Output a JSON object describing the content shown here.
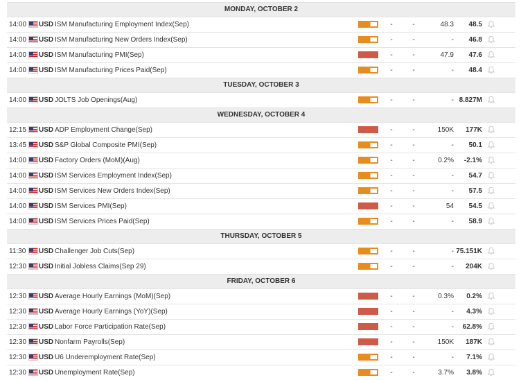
{
  "days": [
    {
      "label": "MONDAY, OCTOBER 2",
      "events": [
        {
          "time": "14:00",
          "currency": "USD",
          "name": "ISM Manufacturing Employment Index(Sep)",
          "impact": "medium",
          "actual": "-",
          "deviation": "-",
          "consensus": "48.3",
          "previous": "48.5"
        },
        {
          "time": "14:00",
          "currency": "USD",
          "name": "ISM Manufacturing New Orders Index(Sep)",
          "impact": "medium",
          "actual": "-",
          "deviation": "-",
          "consensus": "-",
          "previous": "46.8"
        },
        {
          "time": "14:00",
          "currency": "USD",
          "name": "ISM Manufacturing PMI(Sep)",
          "impact": "high",
          "actual": "-",
          "deviation": "-",
          "consensus": "47.9",
          "previous": "47.6"
        },
        {
          "time": "14:00",
          "currency": "USD",
          "name": "ISM Manufacturing Prices Paid(Sep)",
          "impact": "medium",
          "actual": "-",
          "deviation": "-",
          "consensus": "-",
          "previous": "48.4"
        }
      ]
    },
    {
      "label": "TUESDAY, OCTOBER 3",
      "events": [
        {
          "time": "14:00",
          "currency": "USD",
          "name": "JOLTS Job Openings(Aug)",
          "impact": "medium",
          "actual": "-",
          "deviation": "-",
          "consensus": "-",
          "previous": "8.827M"
        }
      ]
    },
    {
      "label": "WEDNESDAY, OCTOBER 4",
      "events": [
        {
          "time": "12:15",
          "currency": "USD",
          "name": "ADP Employment Change(Sep)",
          "impact": "high",
          "actual": "-",
          "deviation": "-",
          "consensus": "150K",
          "previous": "177K"
        },
        {
          "time": "13:45",
          "currency": "USD",
          "name": "S&P Global Composite PMI(Sep)",
          "impact": "medium",
          "actual": "-",
          "deviation": "-",
          "consensus": "-",
          "previous": "50.1"
        },
        {
          "time": "14:00",
          "currency": "USD",
          "name": "Factory Orders (MoM)(Aug)",
          "impact": "medium",
          "actual": "-",
          "deviation": "-",
          "consensus": "0.2%",
          "previous": "-2.1%"
        },
        {
          "time": "14:00",
          "currency": "USD",
          "name": "ISM Services Employment Index(Sep)",
          "impact": "medium",
          "actual": "-",
          "deviation": "-",
          "consensus": "-",
          "previous": "54.7"
        },
        {
          "time": "14:00",
          "currency": "USD",
          "name": "ISM Services New Orders Index(Sep)",
          "impact": "medium",
          "actual": "-",
          "deviation": "-",
          "consensus": "-",
          "previous": "57.5"
        },
        {
          "time": "14:00",
          "currency": "USD",
          "name": "ISM Services PMI(Sep)",
          "impact": "high",
          "actual": "-",
          "deviation": "-",
          "consensus": "54",
          "previous": "54.5"
        },
        {
          "time": "14:00",
          "currency": "USD",
          "name": "ISM Services Prices Paid(Sep)",
          "impact": "medium",
          "actual": "-",
          "deviation": "-",
          "consensus": "-",
          "previous": "58.9"
        }
      ]
    },
    {
      "label": "THURSDAY, OCTOBER 5",
      "events": [
        {
          "time": "11:30",
          "currency": "USD",
          "name": "Challenger Job Cuts(Sep)",
          "impact": "medium",
          "actual": "-",
          "deviation": "-",
          "consensus": "-",
          "previous": "75.151K"
        },
        {
          "time": "12:30",
          "currency": "USD",
          "name": "Initial Jobless Claims(Sep 29)",
          "impact": "medium",
          "actual": "-",
          "deviation": "-",
          "consensus": "-",
          "previous": "204K"
        }
      ]
    },
    {
      "label": "FRIDAY, OCTOBER 6",
      "events": [
        {
          "time": "12:30",
          "currency": "USD",
          "name": "Average Hourly Earnings (MoM)(Sep)",
          "impact": "high",
          "actual": "-",
          "deviation": "-",
          "consensus": "0.3%",
          "previous": "0.2%"
        },
        {
          "time": "12:30",
          "currency": "USD",
          "name": "Average Hourly Earnings (YoY)(Sep)",
          "impact": "high",
          "actual": "-",
          "deviation": "-",
          "consensus": "-",
          "previous": "4.3%"
        },
        {
          "time": "12:30",
          "currency": "USD",
          "name": "Labor Force Participation Rate(Sep)",
          "impact": "high",
          "actual": "-",
          "deviation": "-",
          "consensus": "-",
          "previous": "62.8%"
        },
        {
          "time": "12:30",
          "currency": "USD",
          "name": "Nonfarm Payrolls(Sep)",
          "impact": "high",
          "actual": "-",
          "deviation": "-",
          "consensus": "150K",
          "previous": "187K"
        },
        {
          "time": "12:30",
          "currency": "USD",
          "name": "U6 Underemployment Rate(Sep)",
          "impact": "medium",
          "actual": "-",
          "deviation": "-",
          "consensus": "-",
          "previous": "7.1%"
        },
        {
          "time": "12:30",
          "currency": "USD",
          "name": "Unemployment Rate(Sep)",
          "impact": "medium",
          "actual": "-",
          "deviation": "-",
          "consensus": "3.7%",
          "previous": "3.8%"
        }
      ]
    }
  ],
  "icons": {
    "flag": "us-flag-icon",
    "bell": "bell-icon"
  },
  "colors": {
    "impact_high": "#d05a48",
    "impact_medium": "#e98c1e",
    "day_header_bg": "#ededed"
  }
}
